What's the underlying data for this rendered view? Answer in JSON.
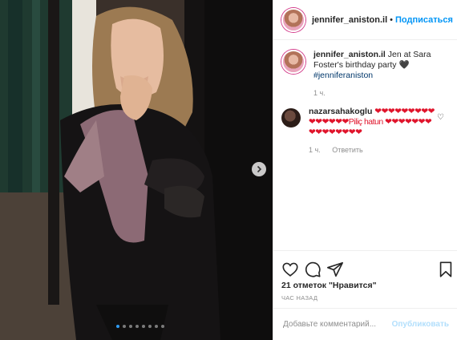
{
  "post": {
    "username": "jennifer_aniston.il",
    "follow_label": "Подписаться",
    "caption_text": "Jen at Sara Foster's birthday party 🖤",
    "caption_tag": "#jenniferaniston",
    "caption_age": "1 ч."
  },
  "comment": {
    "username": "nazarsahakoglu",
    "text": "❤❤❤❤❤❤❤❤❤❤❤❤❤❤❤Piliç hatun ❤❤❤❤❤❤❤❤❤❤❤❤❤❤❤",
    "age": "1 ч.",
    "reply_label": "Ответить"
  },
  "actions": {
    "like_icon": "heart-icon",
    "comment_icon": "comment-icon",
    "share_icon": "share-icon",
    "save_icon": "bookmark-icon"
  },
  "likes_text": "21 отметок \"Нравится\"",
  "timestamp": "час назад",
  "add_comment": {
    "placeholder": "Добавьте комментарий...",
    "publish_label": "Опубликовать"
  },
  "carousel": {
    "slide_count": 8,
    "active_index": 0
  },
  "colors": {
    "accent": "#0095f6",
    "publish_disabled": "#b2dffc",
    "heart_red": "#e0142b",
    "story_ring": "#d33c8b"
  }
}
